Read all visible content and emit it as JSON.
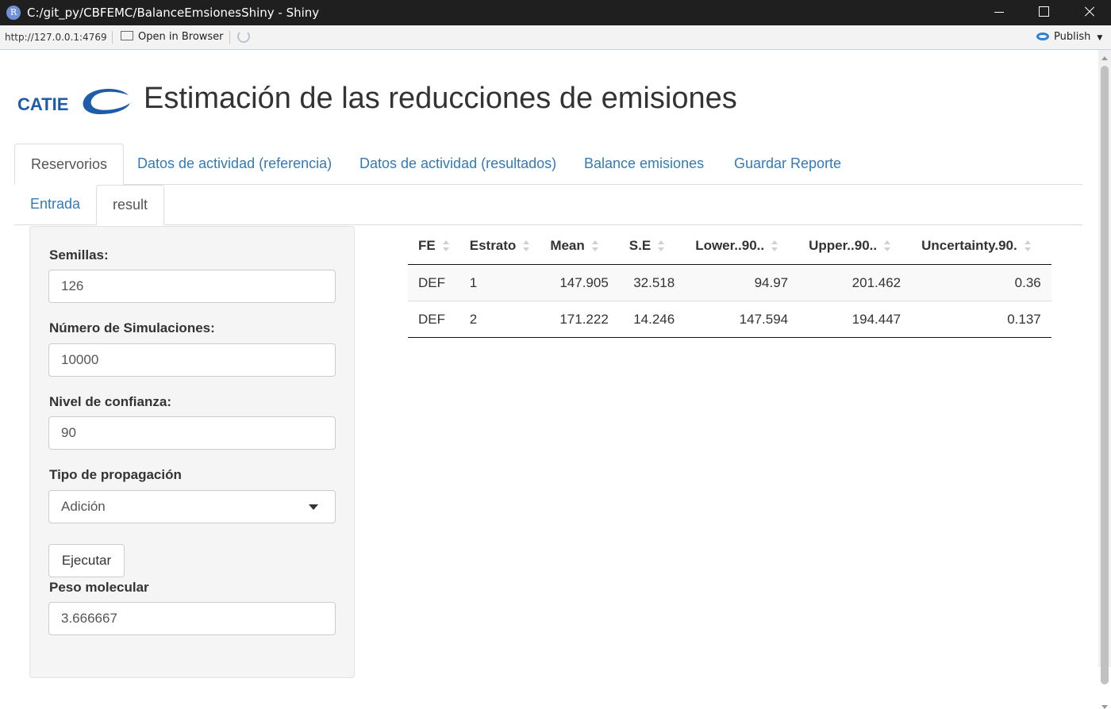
{
  "window": {
    "title": "C:/git_py/CBFEMC/BalanceEmsionesShiny - Shiny",
    "app_icon_letter": "R"
  },
  "viewer": {
    "url": "http://127.0.0.1:4769",
    "open_in_browser": "Open in Browser",
    "publish": "Publish"
  },
  "header": {
    "logo_text": "CATIE",
    "title": "Estimación de las reducciones de emisiones"
  },
  "tabs": [
    {
      "label": "Reservorios",
      "active": true
    },
    {
      "label": "Datos de actividad (referencia)",
      "active": false
    },
    {
      "label": "Datos de actividad (resultados)",
      "active": false
    },
    {
      "label": "Balance emisiones",
      "active": false
    },
    {
      "label": "Guardar Reporte",
      "active": false
    }
  ],
  "subtabs": [
    {
      "label": "Entrada",
      "active": false
    },
    {
      "label": "result",
      "active": true
    }
  ],
  "sidebar": {
    "semillas_label": "Semillas:",
    "semillas_value": "126",
    "simulaciones_label": "Número de Simulaciones:",
    "simulaciones_value": "10000",
    "confianza_label": "Nivel de confianza:",
    "confianza_value": "90",
    "propagacion_label": "Tipo de propagación",
    "propagacion_value": "Adición",
    "run_button": "Ejecutar",
    "peso_label": "Peso molecular",
    "peso_value": "3.666667"
  },
  "table": {
    "columns": [
      "FE",
      "Estrato",
      "Mean",
      "S.E",
      "Lower..90..",
      "Upper..90..",
      "Uncertainty.90."
    ],
    "rows": [
      [
        "DEF",
        "1",
        "147.905",
        "32.518",
        "94.97",
        "201.462",
        "0.36"
      ],
      [
        "DEF",
        "2",
        "171.222",
        "14.246",
        "147.594",
        "194.447",
        "0.137"
      ]
    ]
  },
  "colors": {
    "link": "#337ab7",
    "logo_blue": "#1e5ba8",
    "titlebar": "#1f1f1f"
  }
}
